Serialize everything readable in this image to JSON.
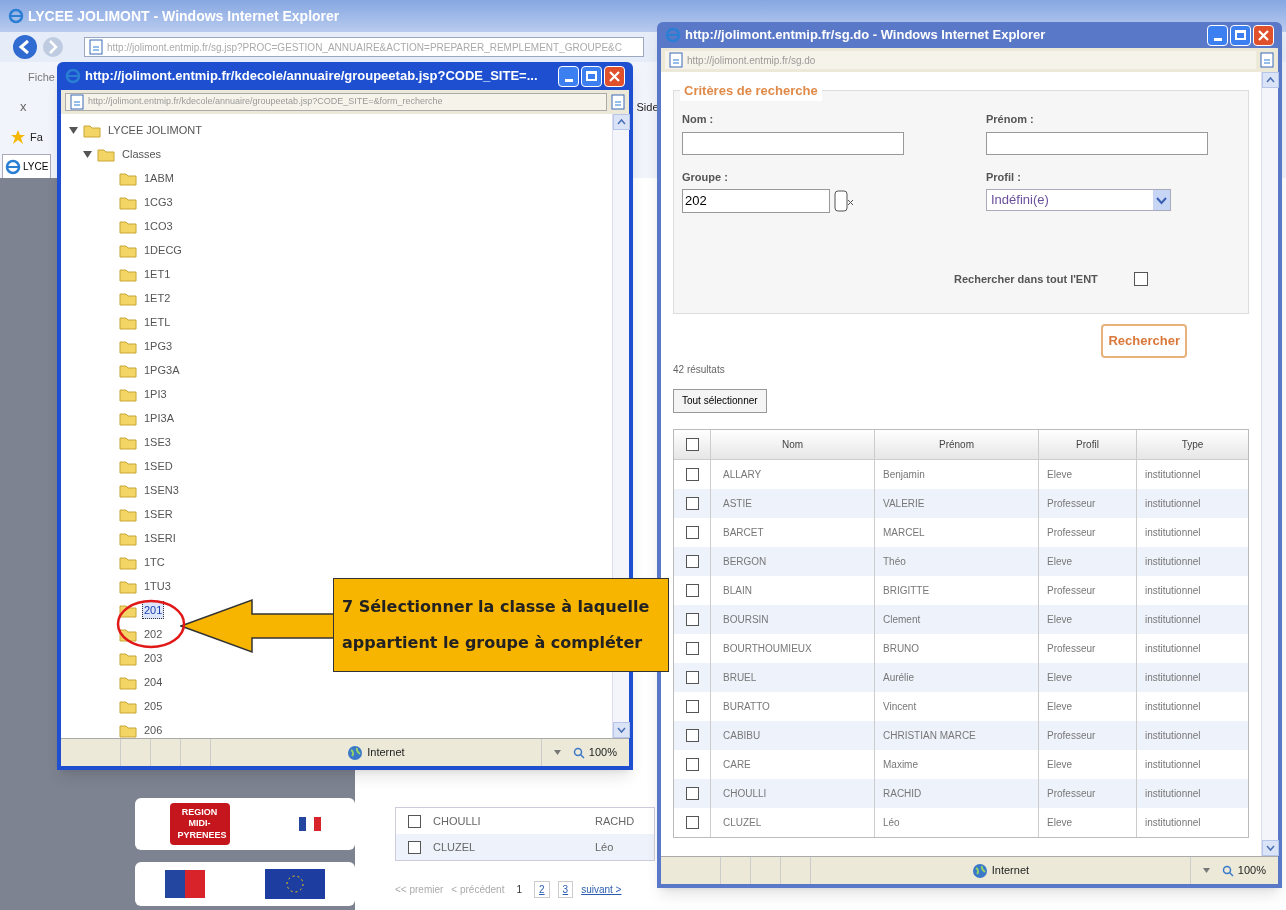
{
  "main_window": {
    "title": "LYCEE JOLIMONT - Windows Internet Explorer",
    "address": "http://jolimont.entmip.fr/sg.jsp?PROC=GESTION_ANNUAIRE&ACTION=PREPARER_REMPLEMENT_GROUPE&C",
    "menu_fragment": "Fiche",
    "toolbar_fragment": "x",
    "side_fragment": "Side",
    "favorites_fragment": "Fa",
    "tab": "LYCE",
    "logo": "REGION MIDI-PYRENEES",
    "table_rows": [
      {
        "nom": "CHOULLI",
        "prenom": "RACHD",
        "checked": false
      },
      {
        "nom": "CLUZEL",
        "prenom": "Léo",
        "checked": false
      }
    ],
    "pagination": [
      {
        "label": "<< premier",
        "kind": "text"
      },
      {
        "label": "< précédent",
        "kind": "text"
      },
      {
        "label": "1",
        "kind": "current"
      },
      {
        "label": "2",
        "kind": "page"
      },
      {
        "label": "3",
        "kind": "page"
      },
      {
        "label": "suivant >",
        "kind": "link"
      }
    ]
  },
  "tree_window": {
    "title": "http://jolimont.entmip.fr/kdecole/annuaire/groupeetab.jsp?CODE_SITE=...",
    "address": "http://jolimont.entmip.fr/kdecole/annuaire/groupeetab.jsp?CODE_SITE=&form_recherche",
    "tree": {
      "label": "LYCEE JOLIMONT",
      "expanded": true,
      "children": [
        {
          "label": "Classes",
          "expanded": true,
          "children": [
            {
              "label": "1ABM",
              "selected": false
            },
            {
              "label": "1CG3",
              "selected": false
            },
            {
              "label": "1CO3",
              "selected": false
            },
            {
              "label": "1DECG",
              "selected": false
            },
            {
              "label": "1ET1",
              "selected": false
            },
            {
              "label": "1ET2",
              "selected": false
            },
            {
              "label": "1ETL",
              "selected": false
            },
            {
              "label": "1PG3",
              "selected": false
            },
            {
              "label": "1PG3A",
              "selected": false
            },
            {
              "label": "1PI3",
              "selected": false
            },
            {
              "label": "1PI3A",
              "selected": false
            },
            {
              "label": "1SE3",
              "selected": false
            },
            {
              "label": "1SED",
              "selected": false
            },
            {
              "label": "1SEN3",
              "selected": false
            },
            {
              "label": "1SER",
              "selected": false
            },
            {
              "label": "1SERI",
              "selected": false
            },
            {
              "label": "1TC",
              "selected": false
            },
            {
              "label": "1TU3",
              "selected": false
            },
            {
              "label": "201",
              "selected": true
            },
            {
              "label": "202",
              "selected": false
            },
            {
              "label": "203",
              "selected": false
            },
            {
              "label": "204",
              "selected": false
            },
            {
              "label": "205",
              "selected": false
            },
            {
              "label": "206",
              "selected": false
            }
          ]
        }
      ]
    },
    "status": "Internet",
    "zoom": "100%"
  },
  "search_window": {
    "title": "http://jolimont.entmip.fr/sg.do - Windows Internet Explorer",
    "address": "http://jolimont.entmip.fr/sg.do",
    "legend": "Critères de recherche",
    "nom_label": "Nom :",
    "prenom_label": "Prénom :",
    "groupe_label": "Groupe :",
    "groupe_value": "202",
    "profil_label": "Profil :",
    "profil_value": "Indéfini(e)",
    "ent_label": "Rechercher dans tout l'ENT",
    "ent_checked": false,
    "search_button": "Rechercher",
    "results": "42 résultats",
    "select_all": "Tout sélectionner",
    "columns": [
      "Nom",
      "Prénom",
      "Profil",
      "Type"
    ],
    "header_checked": false,
    "rows": [
      {
        "nom": "ALLARY",
        "prenom": "Benjamin",
        "profil": "Eleve",
        "type": "institutionnel",
        "checked": false
      },
      {
        "nom": "ASTIE",
        "prenom": "VALERIE",
        "profil": "Professeur",
        "type": "institutionnel",
        "checked": false
      },
      {
        "nom": "BARCET",
        "prenom": "MARCEL",
        "profil": "Professeur",
        "type": "institutionnel",
        "checked": false
      },
      {
        "nom": "BERGON",
        "prenom": "Théo",
        "profil": "Eleve",
        "type": "institutionnel",
        "checked": false
      },
      {
        "nom": "BLAIN",
        "prenom": "BRIGITTE",
        "profil": "Professeur",
        "type": "institutionnel",
        "checked": false
      },
      {
        "nom": "BOURSIN",
        "prenom": "Clement",
        "profil": "Eleve",
        "type": "institutionnel",
        "checked": false
      },
      {
        "nom": "BOURTHOUMIEUX",
        "prenom": "BRUNO",
        "profil": "Professeur",
        "type": "institutionnel",
        "checked": false
      },
      {
        "nom": "BRUEL",
        "prenom": "Aurélie",
        "profil": "Eleve",
        "type": "institutionnel",
        "checked": false
      },
      {
        "nom": "BURATTO",
        "prenom": "Vincent",
        "profil": "Eleve",
        "type": "institutionnel",
        "checked": false
      },
      {
        "nom": "CABIBU",
        "prenom": "CHRISTIAN MARCE",
        "profil": "Professeur",
        "type": "institutionnel",
        "checked": false
      },
      {
        "nom": "CARE",
        "prenom": "Maxime",
        "profil": "Eleve",
        "type": "institutionnel",
        "checked": false
      },
      {
        "nom": "CHOULLI",
        "prenom": "RACHID",
        "profil": "Professeur",
        "type": "institutionnel",
        "checked": false
      },
      {
        "nom": "CLUZEL",
        "prenom": "Léo",
        "profil": "Eleve",
        "type": "institutionnel",
        "checked": false
      }
    ],
    "status": "Internet",
    "zoom": "100%"
  },
  "callout": {
    "text": "7 Sélectionner la classe à laquelle appartient le groupe à compléter"
  }
}
